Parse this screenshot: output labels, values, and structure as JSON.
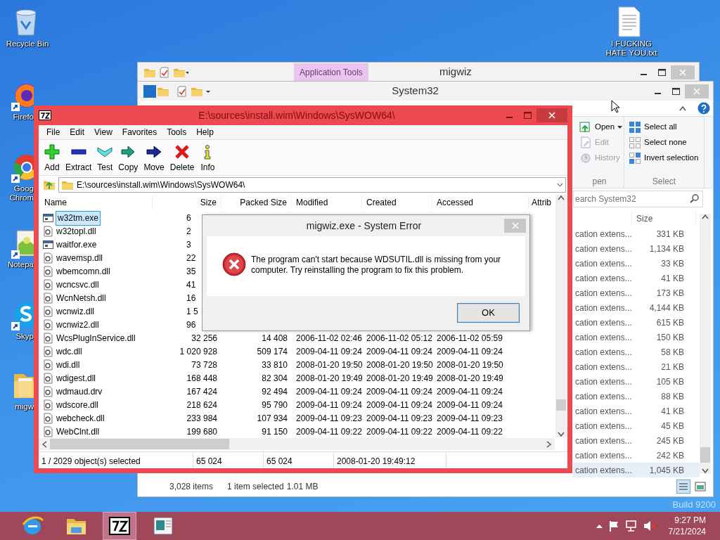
{
  "desktop_icons": [
    {
      "kind": "recycle",
      "lines": [
        "Recycle Bin"
      ],
      "shortcut": false
    },
    {
      "kind": "textfile",
      "lines": [
        "I FUCKING",
        "HATE YOU.txt"
      ],
      "shortcut": false
    },
    {
      "kind": "firefox",
      "lines": [
        "Firefo"
      ],
      "shortcut": true
    },
    {
      "kind": "chrome",
      "lines": [
        "Goog",
        "Chrom"
      ],
      "shortcut": true
    },
    {
      "kind": "notepad",
      "lines": [
        "Notepa"
      ],
      "shortcut": true
    },
    {
      "kind": "skype",
      "lines": [
        "Skyp"
      ],
      "shortcut": true
    },
    {
      "kind": "folder",
      "lines": [
        "migw"
      ],
      "shortcut": false
    }
  ],
  "build_label": "Build 9200",
  "migwiz_window": {
    "contextual_tab": "Application Tools",
    "title": "migwiz"
  },
  "explorer": {
    "title": "System32",
    "open_group": {
      "caption": "pen",
      "items": [
        {
          "kind": "open",
          "label": "Open",
          "disabled": false
        },
        {
          "kind": "edit",
          "label": "Edit",
          "disabled": true
        },
        {
          "kind": "history",
          "label": "History",
          "disabled": true
        }
      ]
    },
    "select_group": {
      "caption": "Select",
      "items": [
        {
          "kind": "all",
          "label": "Select all"
        },
        {
          "kind": "none",
          "label": "Select none"
        },
        {
          "kind": "invert",
          "label": "Invert selection"
        }
      ]
    },
    "search_placeholder": "earch System32",
    "size_column": "Size",
    "rows": [
      {
        "type": "cation extens...",
        "size": "331 KB",
        "selected": false
      },
      {
        "type": "cation extens...",
        "size": "1,134 KB",
        "selected": false
      },
      {
        "type": "cation extens...",
        "size": "33 KB",
        "selected": false
      },
      {
        "type": "cation extens...",
        "size": "41 KB",
        "selected": false
      },
      {
        "type": "cation extens...",
        "size": "173 KB",
        "selected": false
      },
      {
        "type": "cation extens...",
        "size": "4,144 KB",
        "selected": false
      },
      {
        "type": "cation extens...",
        "size": "615 KB",
        "selected": false
      },
      {
        "type": "cation extens...",
        "size": "150 KB",
        "selected": false
      },
      {
        "type": "cation extens...",
        "size": "58 KB",
        "selected": false
      },
      {
        "type": "cation extens...",
        "size": "21 KB",
        "selected": false
      },
      {
        "type": "cation extens...",
        "size": "105 KB",
        "selected": false
      },
      {
        "type": "cation extens...",
        "size": "88 KB",
        "selected": false
      },
      {
        "type": "cation extens...",
        "size": "41 KB",
        "selected": false
      },
      {
        "type": "cation extens...",
        "size": "45 KB",
        "selected": false
      },
      {
        "type": "cation extens...",
        "size": "245 KB",
        "selected": false
      },
      {
        "type": "cation extens...",
        "size": "242 KB",
        "selected": false
      },
      {
        "type": "cation extens...",
        "size": "1,045 KB",
        "selected": true
      }
    ],
    "status": {
      "count": "3,028 items",
      "selection": "1 item selected",
      "size": "1.01 MB"
    }
  },
  "sevenzip": {
    "title": "E:\\sources\\install.wim\\Windows\\SysWOW64\\",
    "menu": [
      "File",
      "Edit",
      "View",
      "Favorites",
      "Tools",
      "Help"
    ],
    "toolbar": [
      {
        "kind": "add",
        "label": "Add"
      },
      {
        "kind": "extract",
        "label": "Extract"
      },
      {
        "kind": "test",
        "label": "Test"
      },
      {
        "kind": "copy",
        "label": "Copy"
      },
      {
        "kind": "move",
        "label": "Move"
      },
      {
        "kind": "delete",
        "label": "Delete"
      },
      {
        "kind": "info",
        "label": "Info"
      }
    ],
    "address": "E:\\sources\\install.wim\\Windows\\SysWOW64\\",
    "columns": [
      "Name",
      "Size",
      "Packed Size",
      "Modified",
      "Created",
      "Accessed",
      "Attrib"
    ],
    "rows": [
      {
        "kind": "exe",
        "selected": true,
        "cells": [
          "w32tm.exe",
          "6"
        ]
      },
      {
        "kind": "dll",
        "selected": false,
        "cells": [
          "w32topl.dll",
          "2"
        ]
      },
      {
        "kind": "exe",
        "selected": false,
        "cells": [
          "waitfor.exe",
          "3"
        ]
      },
      {
        "kind": "dll",
        "selected": false,
        "cells": [
          "wavemsp.dll",
          "22"
        ]
      },
      {
        "kind": "dll",
        "selected": false,
        "cells": [
          "wbemcomn.dll",
          "35"
        ]
      },
      {
        "kind": "dll",
        "selected": false,
        "cells": [
          "wcncsvc.dll",
          "41"
        ]
      },
      {
        "kind": "dll",
        "selected": false,
        "cells": [
          "WcnNetsh.dll",
          "16"
        ]
      },
      {
        "kind": "dll",
        "selected": false,
        "cells": [
          "wcnwiz.dll",
          "1 5"
        ]
      },
      {
        "kind": "dll",
        "selected": false,
        "cells": [
          "wcnwiz2.dll",
          "96"
        ]
      },
      {
        "kind": "dll",
        "selected": false,
        "cells": [
          "WcsPlugInService.dll",
          "32 256",
          "14 408",
          "2006-11-02 02:46",
          "2006-11-02 05:12",
          "2006-11-02 05:59"
        ]
      },
      {
        "kind": "dll",
        "selected": false,
        "cells": [
          "wdc.dll",
          "1 020 928",
          "509 174",
          "2009-04-11 09:24",
          "2009-04-11 09:24",
          "2009-04-11 09:24"
        ]
      },
      {
        "kind": "dll",
        "selected": false,
        "cells": [
          "wdi.dll",
          "73 728",
          "33 810",
          "2008-01-20 19:50",
          "2008-01-20 19:50",
          "2008-01-20 19:50"
        ]
      },
      {
        "kind": "dll",
        "selected": false,
        "cells": [
          "wdigest.dll",
          "168 448",
          "82 304",
          "2008-01-20 19:49",
          "2008-01-20 19:49",
          "2008-01-20 19:49"
        ]
      },
      {
        "kind": "dll",
        "selected": false,
        "cells": [
          "wdmaud.drv",
          "167 424",
          "92 494",
          "2009-04-11 09:24",
          "2009-04-11 09:24",
          "2009-04-11 09:24"
        ]
      },
      {
        "kind": "dll",
        "selected": false,
        "cells": [
          "wdscore.dll",
          "218 624",
          "95 790",
          "2009-04-11 09:24",
          "2009-04-11 09:24",
          "2009-04-11 09:24"
        ]
      },
      {
        "kind": "dll",
        "selected": false,
        "cells": [
          "webcheck.dll",
          "233 984",
          "107 934",
          "2009-04-11 09:23",
          "2009-04-11 09:23",
          "2009-04-11 09:23"
        ]
      },
      {
        "kind": "dll",
        "selected": false,
        "cells": [
          "WebClnt.dll",
          "199 680",
          "91 150",
          "2009-04-11 09:22",
          "2009-04-11 09:22",
          "2009-04-11 09:22"
        ]
      }
    ],
    "status": [
      "1 / 2029 object(s) selected",
      "65 024",
      "65 024",
      "2008-01-20 19:49:12"
    ]
  },
  "dialog": {
    "title": "migwiz.exe - System Error",
    "message": "The program can't start because WDSUTIL.dll is missing from your computer. Try reinstalling the program to fix this problem.",
    "button": "OK"
  },
  "taskbar": {
    "apps": [
      {
        "kind": "ie",
        "active": false
      },
      {
        "kind": "explorer",
        "active": false
      },
      {
        "kind": "sevenzip",
        "active": true
      },
      {
        "kind": "window",
        "active": false
      }
    ],
    "time": "9:27 PM",
    "date": "7/21/2024"
  }
}
